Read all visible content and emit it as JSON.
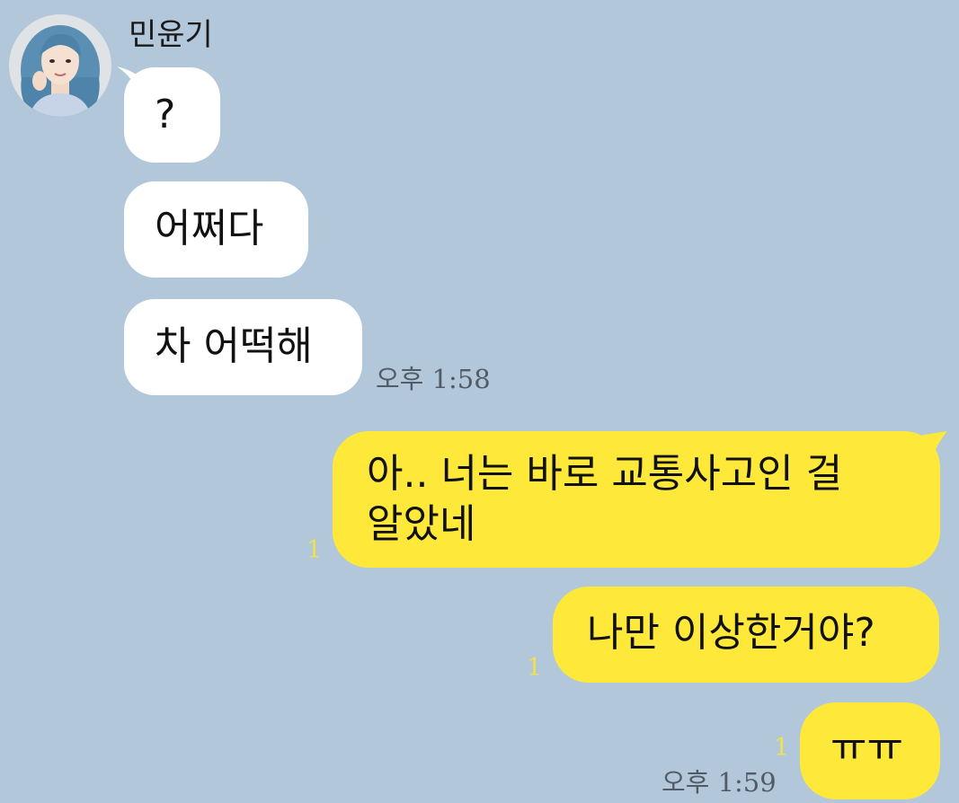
{
  "chat": {
    "sender": {
      "name": "민윤기"
    },
    "incoming": [
      {
        "text": "?"
      },
      {
        "text": "어쩌다"
      },
      {
        "text": "차 어떡해"
      }
    ],
    "incoming_time": "오후 1:58",
    "outgoing": [
      {
        "line1": "아.. 너는 바로 교통사고인 걸",
        "line2": "알았네",
        "unread": "1"
      },
      {
        "text": "나만 이상한거야?",
        "unread": "1"
      },
      {
        "text": "ㅠㅠ",
        "unread": "1"
      }
    ],
    "outgoing_time": "오후 1:59"
  },
  "colors": {
    "background": "#b2c7d9",
    "incoming_bubble": "#ffffff",
    "outgoing_bubble": "#fee93a",
    "unread_count": "#eee24d",
    "timestamp": "#525c66"
  }
}
